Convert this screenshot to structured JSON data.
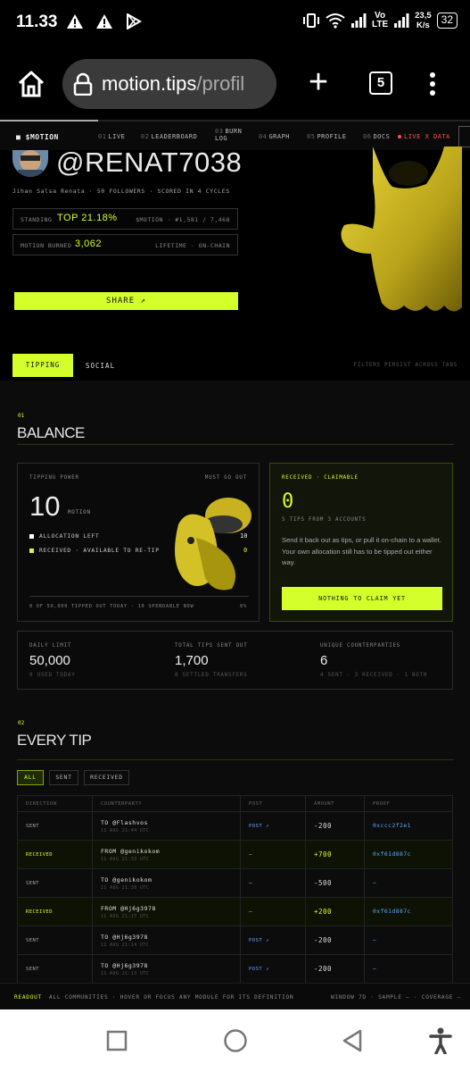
{
  "status_bar": {
    "time": "11.33",
    "network_lte": "Vo\nLTE",
    "speed_value": "23,5",
    "speed_unit": "K/s",
    "battery": "32"
  },
  "browser": {
    "url_host": "motion.tips",
    "url_path": "/profil",
    "tab_count": "5"
  },
  "topnav": {
    "brand": "$MOTION",
    "items": [
      {
        "num": "01",
        "label": "LIVE"
      },
      {
        "num": "02",
        "label": "LEADERBOARD"
      },
      {
        "num": "03",
        "label": "BURN LOG"
      },
      {
        "num": "04",
        "label": "GRAPH"
      },
      {
        "num": "05",
        "label": "PROFILE"
      },
      {
        "num": "06",
        "label": "DOCS"
      }
    ],
    "live_data": "LIVE X DATA"
  },
  "profile": {
    "handle": "@RENAT7038",
    "meta": "Jihan Salsa Renata · 50 FOLLOWERS · SCORED IN 4 CYCLES",
    "standing_label": "STANDING",
    "standing_value": "TOP 21.18%",
    "standing_right": "$MOTION · #1,581 / 7,468",
    "burned_label": "MOTION BURNED",
    "burned_value": "3,062",
    "burned_right": "LIFETIME · ON-CHAIN",
    "share_label": "SHARE ↗"
  },
  "tabs": {
    "active": "TIPPING",
    "inactive": "SOCIAL",
    "note": "FILTERS PERSIST ACROSS TABS"
  },
  "balance": {
    "num": "01",
    "title": "BALANCE",
    "power_label": "TIPPING POWER",
    "power_right": "MUST GO OUT",
    "power_value": "10",
    "power_unit": "MOTION",
    "alloc_label": "ALLOCATION LEFT",
    "alloc_value": "10",
    "received_label": "RECEIVED · AVAILABLE TO RE-TIP",
    "received_value": "0",
    "progress_label": "0 OF 50,000 TIPPED OUT TODAY · 10 SPENDABLE NOW",
    "progress_pct": "0%",
    "claim_label": "RECEIVED · CLAIMABLE",
    "claim_value": "0",
    "claim_sub": "5 TIPS FROM 3 ACCOUNTS",
    "claim_text": "Send it back out as tips, or pull it on-chain to a wallet. Your own allocation still has to be tipped out either way.",
    "claim_button": "NOTHING TO CLAIM YET",
    "stats": [
      {
        "label": "DAILY LIMIT",
        "value": "50,000",
        "sub": "0 USED TODAY"
      },
      {
        "label": "TOTAL TIPS SENT OUT",
        "value": "1,700",
        "sub": "8 SETTLED TRANSFERS"
      },
      {
        "label": "UNIQUE COUNTERPARTIES",
        "value": "6",
        "sub": "4 SENT · 3 RECEIVED · 1 BOTH"
      }
    ]
  },
  "every_tip": {
    "num": "02",
    "title": "EVERY TIP",
    "filters": [
      "ALL",
      "SENT",
      "RECEIVED"
    ],
    "columns": [
      "DIRECTION",
      "COUNTERPARTY",
      "POST",
      "AMOUNT",
      "PROOF"
    ],
    "rows": [
      {
        "dir": "SENT",
        "cp": "TO @Flashvos",
        "ts": "11 AUG 21:44 UTC",
        "post": "POST ↗",
        "amount": "-200",
        "proof": "0xccc2f2e1"
      },
      {
        "dir": "RECEIVED",
        "cp": "FROM @genikokom",
        "ts": "11 AUG 21:33 UTC",
        "post": "—",
        "amount": "+700",
        "proof": "0xf61d887c"
      },
      {
        "dir": "SENT",
        "cp": "TO @genikokom",
        "ts": "11 AUG 21:30 UTC",
        "post": "—",
        "amount": "-500",
        "proof": "—"
      },
      {
        "dir": "RECEIVED",
        "cp": "FROM @Hj6g3978",
        "ts": "11 AUG 21:17 UTC",
        "post": "—",
        "amount": "+200",
        "proof": "0xf61d887c"
      },
      {
        "dir": "SENT",
        "cp": "TO @Hj6g3978",
        "ts": "11 AUG 21:14 UTC",
        "post": "POST ↗",
        "amount": "-200",
        "proof": "—"
      },
      {
        "dir": "SENT",
        "cp": "TO @Hj6g3978",
        "ts": "11 AUG 21:13 UTC",
        "post": "POST ↗",
        "amount": "-200",
        "proof": "—"
      }
    ]
  },
  "readout": {
    "key": "READOUT",
    "msg": "ALL COMMUNITIES · HOVER OR FOCUS ANY MODULE FOR ITS DEFINITION",
    "right": "WINDOW 7D · SAMPLE — · COVERAGE —"
  },
  "colors": {
    "accent": "#d4ff2b",
    "link": "#5da7ff",
    "live": "#ff5151"
  },
  "icons": [
    "warning-icon",
    "play-store-icon",
    "vibrate-icon",
    "wifi-icon",
    "signal-icon",
    "home-icon",
    "lock-icon",
    "plus-icon",
    "more-icon",
    "recent-apps-icon",
    "home-circle-icon",
    "back-icon",
    "accessibility-icon"
  ]
}
